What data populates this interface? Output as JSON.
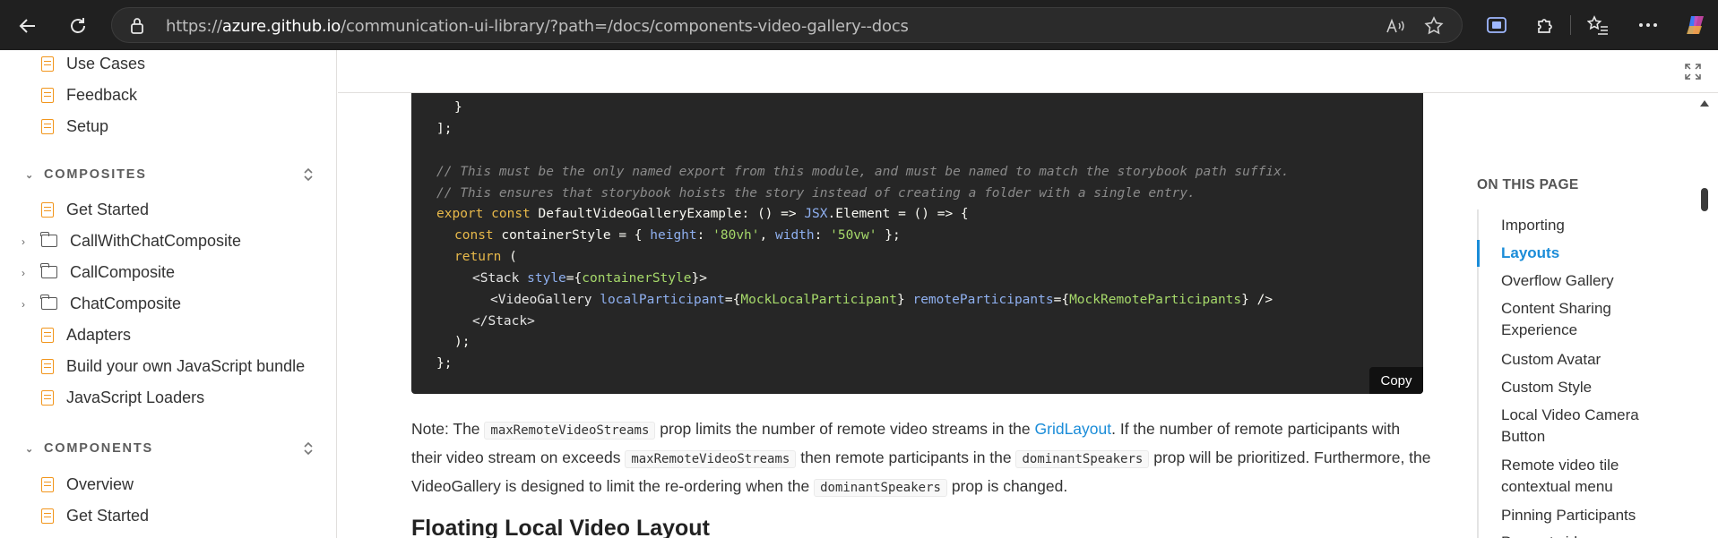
{
  "browser": {
    "url_prefix": "https://",
    "url_host": "azure.github.io",
    "url_path": "/communication-ui-library/?path=/docs/components-video-gallery--docs"
  },
  "sidebar": {
    "top_items": [
      "Use Cases",
      "Feedback",
      "Setup"
    ],
    "composites_label": "COMPOSITES",
    "composites_items": [
      {
        "label": "Get Started",
        "kind": "doc"
      },
      {
        "label": "CallWithChatComposite",
        "kind": "folder"
      },
      {
        "label": "CallComposite",
        "kind": "folder"
      },
      {
        "label": "ChatComposite",
        "kind": "folder"
      },
      {
        "label": "Adapters",
        "kind": "doc"
      },
      {
        "label": "Build your own JavaScript bundle",
        "kind": "doc"
      },
      {
        "label": "JavaScript Loaders",
        "kind": "doc"
      }
    ],
    "components_label": "COMPONENTS",
    "components_items": [
      "Overview",
      "Get Started"
    ]
  },
  "code": {
    "copy_label": "Copy",
    "l1": "}",
    "l2": "];",
    "l3": "// This must be the only named export from this module, and must be named to match the storybook path suffix.",
    "l4": "// This ensures that storybook hoists the story instead of creating a folder with a single entry.",
    "l5_kw1": "export",
    "l5_kw2": "const",
    "l5_a": " DefaultVideoGalleryExample: () => ",
    "l5_ty": "JSX",
    "l5_b": ".Element = () => {",
    "l6_kw": "const",
    "l6_a": " containerStyle = { ",
    "l6_k1": "height",
    "l6_b": ": ",
    "l6_v1": "'80vh'",
    "l6_c": ", ",
    "l6_k2": "width",
    "l6_d": ": ",
    "l6_v2": "'50vw'",
    "l6_e": " };",
    "l7_kw": "return",
    "l7_a": " (",
    "l8_tag": "<Stack",
    "l8_at": "style",
    "l8_a": "={",
    "l8_ex": "containerStyle",
    "l8_b": "}>",
    "l9_tag": "<VideoGallery",
    "l9_at1": "localParticipant",
    "l9_a": "={",
    "l9_ex1": "MockLocalParticipant",
    "l9_b": "} ",
    "l9_at2": "remoteParticipants",
    "l9_c": "={",
    "l9_ex2": "MockRemoteParticipants",
    "l9_d": "} />",
    "l10": "</Stack>",
    "l11": ");",
    "l12": "};"
  },
  "note": {
    "t1": "Note: The ",
    "c1": "maxRemoteVideoStreams",
    "t2": " prop limits the number of remote video streams in the ",
    "link": "GridLayout",
    "t3": ". If the number of remote participants with their video stream on exceeds ",
    "c2": "maxRemoteVideoStreams",
    "t4": " then remote participants in the ",
    "c3": "dominantSpeakers",
    "t5": " prop will be prioritized. Furthermore, the VideoGallery is designed to limit the re-ordering when the ",
    "c4": "dominantSpeakers",
    "t6": " prop is changed."
  },
  "heading_next": "Floating Local Video Layout",
  "toc": {
    "title": "ON THIS PAGE",
    "items": [
      "Importing",
      "Layouts",
      "Overflow Gallery",
      "Content Sharing Experience",
      "Custom Avatar",
      "Custom Style",
      "Local Video Camera Button",
      "Remote video tile contextual menu",
      "Pinning Participants",
      "Prevent video..."
    ],
    "active": "Layouts"
  },
  "colors": {
    "accent": "#1a8cd8",
    "doc_icon": "#f2961d",
    "code_bg": "#262626"
  }
}
